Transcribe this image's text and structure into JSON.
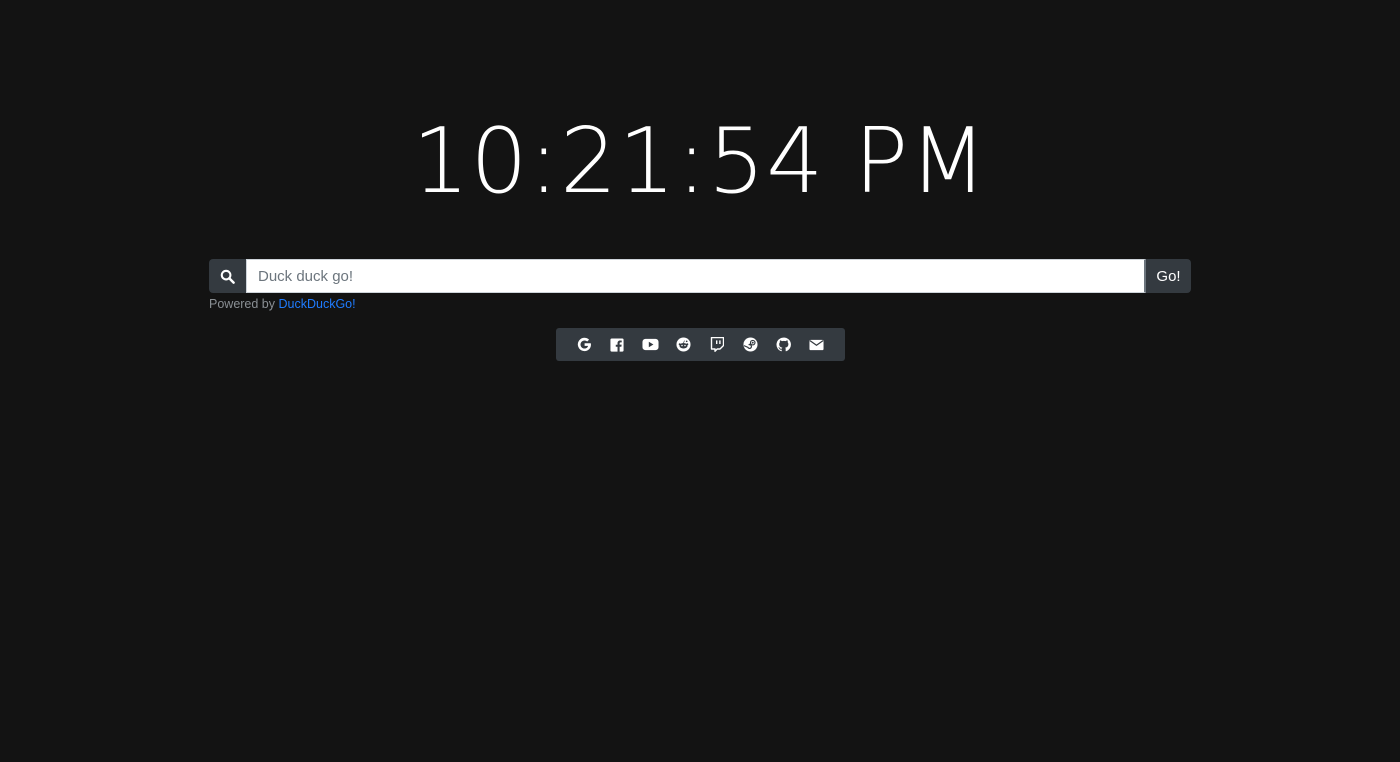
{
  "clock": {
    "time": "10:21:54 PM"
  },
  "search": {
    "icon": "search-icon",
    "placeholder": "Duck duck go!",
    "value": "",
    "go_label": "Go!",
    "powered_prefix": "Powered by ",
    "powered_link": "DuckDuckGo!"
  },
  "links": [
    {
      "name": "google",
      "icon": "google-icon"
    },
    {
      "name": "facebook",
      "icon": "facebook-icon"
    },
    {
      "name": "youtube",
      "icon": "youtube-icon"
    },
    {
      "name": "reddit",
      "icon": "reddit-icon"
    },
    {
      "name": "twitch",
      "icon": "twitch-icon"
    },
    {
      "name": "steam",
      "icon": "steam-icon"
    },
    {
      "name": "github",
      "icon": "github-icon"
    },
    {
      "name": "email",
      "icon": "envelope-icon"
    }
  ],
  "colors": {
    "background": "#131313",
    "panel": "#343a40",
    "link": "#1f7cff",
    "text": "#ffffff"
  }
}
